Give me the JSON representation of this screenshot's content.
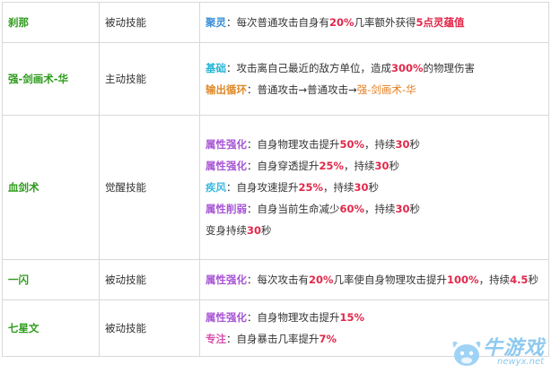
{
  "colors": {
    "name": "#2e9b1c",
    "highlight": "#e2284a",
    "label_passive": "#3b8fd8",
    "label_basic": "#29b6d6",
    "label_cycle": "#e08a2a",
    "label_attr": "#a855d6",
    "label_gale": "#3bb8e0",
    "label_focus": "#d94fb0",
    "result_skill": "#e67e22"
  },
  "rows": [
    {
      "name": "刹那",
      "type": "被动技能",
      "lines": [
        [
          {
            "t": "聚灵",
            "s": "label",
            "c": "#3b8fd8"
          },
          {
            "t": "：每次普通攻击自身有"
          },
          {
            "t": "20%",
            "s": "hl"
          },
          {
            "t": "几率额外获得"
          },
          {
            "t": "5点灵蕴值",
            "s": "hl"
          }
        ]
      ]
    },
    {
      "name": "强-剑画术-华",
      "type": "主动技能",
      "lines": [
        [
          {
            "t": "基础",
            "s": "label",
            "c": "#29b6d6"
          },
          {
            "t": "：攻击离自己最近的敌方单位，造成"
          },
          {
            "t": "300%",
            "s": "hl"
          },
          {
            "t": "的物理伤害"
          }
        ],
        [
          {
            "t": "输出循环",
            "s": "label",
            "c": "#e08a2a"
          },
          {
            "t": "：普通攻击→普通攻击→"
          },
          {
            "t": "强-剑画术-华",
            "s": "orange"
          }
        ]
      ]
    },
    {
      "name": "血剑术",
      "type": "觉醒技能",
      "lines": [
        [
          {
            "t": "属性强化",
            "s": "label",
            "c": "#a855d6"
          },
          {
            "t": "：自身物理攻击提升"
          },
          {
            "t": "50%",
            "s": "hl"
          },
          {
            "t": "，持续"
          },
          {
            "t": "30",
            "s": "hl"
          },
          {
            "t": "秒"
          }
        ],
        [
          {
            "t": "属性强化",
            "s": "label",
            "c": "#a855d6"
          },
          {
            "t": "：自身穿透提升"
          },
          {
            "t": "25%",
            "s": "hl"
          },
          {
            "t": "，持续"
          },
          {
            "t": "30",
            "s": "hl"
          },
          {
            "t": "秒"
          }
        ],
        [
          {
            "t": "疾风",
            "s": "label",
            "c": "#3bb8e0"
          },
          {
            "t": "：自身攻速提升"
          },
          {
            "t": "25%",
            "s": "hl"
          },
          {
            "t": "，持续"
          },
          {
            "t": "30",
            "s": "hl"
          },
          {
            "t": "秒"
          }
        ],
        [
          {
            "t": "属性削弱",
            "s": "label",
            "c": "#a855d6"
          },
          {
            "t": "：自身当前生命减少"
          },
          {
            "t": "60%",
            "s": "hl"
          },
          {
            "t": "，持续"
          },
          {
            "t": "30",
            "s": "hl"
          },
          {
            "t": "秒"
          }
        ],
        [
          {
            "t": "变身持续"
          },
          {
            "t": "30",
            "s": "hl"
          },
          {
            "t": "秒"
          }
        ]
      ]
    },
    {
      "name": "一闪",
      "type": "被动技能",
      "lines": [
        [
          {
            "t": "属性强化",
            "s": "label",
            "c": "#a855d6"
          },
          {
            "t": "：每次攻击有"
          },
          {
            "t": "20%",
            "s": "hl"
          },
          {
            "t": "几率使自身物理攻击提升"
          },
          {
            "t": "100%",
            "s": "hl"
          },
          {
            "t": "，持续"
          },
          {
            "t": "4.5",
            "s": "hl"
          },
          {
            "t": "秒"
          }
        ]
      ]
    },
    {
      "name": "七星文",
      "type": "被动技能",
      "lines": [
        [
          {
            "t": "属性强化",
            "s": "label",
            "c": "#a855d6"
          },
          {
            "t": "：自身物理攻击提升"
          },
          {
            "t": "15%",
            "s": "hl"
          }
        ],
        [
          {
            "t": "专注",
            "s": "label",
            "c": "#d94fb0"
          },
          {
            "t": "：自身暴击几率提升"
          },
          {
            "t": "7%",
            "s": "hl"
          }
        ]
      ]
    }
  ],
  "watermark": {
    "text": "牛游戏",
    "url": "newyx.net"
  }
}
